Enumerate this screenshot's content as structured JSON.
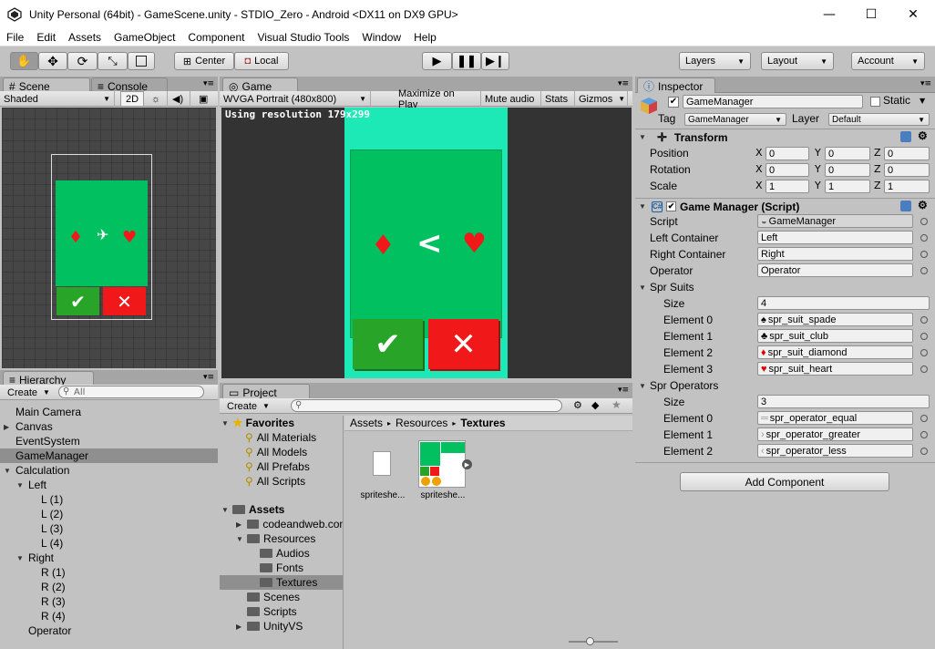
{
  "window": {
    "title": "Unity Personal (64bit) - GameScene.unity - STDIO_Zero - Android <DX11 on DX9 GPU>",
    "minimize": "—",
    "maximize": "☐",
    "close": "✕"
  },
  "menu": [
    "File",
    "Edit",
    "Assets",
    "GameObject",
    "Component",
    "Visual Studio Tools",
    "Window",
    "Help"
  ],
  "toolbar": {
    "center_label": "Center",
    "local_label": "Local",
    "layers_label": "Layers",
    "layout_label": "Layout",
    "account_label": "Account"
  },
  "scene": {
    "tab_label": "Scene",
    "console_tab_label": "Console",
    "shading": "Shaded",
    "mode2d": "2D"
  },
  "game": {
    "tab_label": "Game",
    "aspect": "WVGA Portrait (480x800)",
    "maximize_on_play": "Maximize on Play",
    "mute_audio": "Mute audio",
    "stats": "Stats",
    "gizmos": "Gizmos",
    "resolution_text": "Using resolution 179x299"
  },
  "hierarchy": {
    "tab_label": "Hierarchy",
    "create_label": "Create",
    "search_placeholder": "All",
    "items": [
      {
        "label": "Main Camera"
      },
      {
        "label": "Canvas"
      },
      {
        "label": "EventSystem"
      },
      {
        "label": "GameManager"
      },
      {
        "label": "Calculation"
      },
      {
        "label": "Left"
      },
      {
        "label": "L (1)"
      },
      {
        "label": "L (2)"
      },
      {
        "label": "L (3)"
      },
      {
        "label": "L (4)"
      },
      {
        "label": "Right"
      },
      {
        "label": "R (1)"
      },
      {
        "label": "R (2)"
      },
      {
        "label": "R (3)"
      },
      {
        "label": "R (4)"
      },
      {
        "label": "Operator"
      }
    ]
  },
  "project": {
    "tab_label": "Project",
    "create_label": "Create",
    "favorites_label": "Favorites",
    "favorites": [
      "All Materials",
      "All Models",
      "All Prefabs",
      "All Scripts"
    ],
    "assets_label": "Assets",
    "assets": [
      "codeandweb.com",
      "Resources",
      "Audios",
      "Fonts",
      "Textures",
      "Scenes",
      "Scripts",
      "UnityVS"
    ],
    "breadcrumb": [
      "Assets",
      "Resources",
      "Textures"
    ],
    "files": [
      "spritesheet",
      "spritesheet"
    ],
    "file_display": [
      "spriteshe...",
      "spriteshe..."
    ]
  },
  "inspector": {
    "tab_label": "Inspector",
    "object_name": "GameManager",
    "static_label": "Static",
    "tag_label": "Tag",
    "tag_value": "GameManager",
    "layer_label": "Layer",
    "layer_value": "Default",
    "transform": {
      "title": "Transform",
      "position_label": "Position",
      "rotation_label": "Rotation",
      "scale_label": "Scale",
      "position": {
        "x": "0",
        "y": "0",
        "z": "0"
      },
      "rotation": {
        "x": "0",
        "y": "0",
        "z": "0"
      },
      "scale": {
        "x": "1",
        "y": "1",
        "z": "1"
      },
      "axis_x": "X",
      "axis_y": "Y",
      "axis_z": "Z"
    },
    "script_component": {
      "title": "Game Manager (Script)",
      "script_label": "Script",
      "script_value": "GameManager",
      "left_container_label": "Left Container",
      "left_container_value": "Left",
      "right_container_label": "Right Container",
      "right_container_value": "Right",
      "operator_label": "Operator",
      "operator_value": "Operator",
      "spr_suits_label": "Spr Suits",
      "size_label": "Size",
      "suits_size": "4",
      "suits": [
        {
          "label": "Element 0",
          "value": "spr_suit_spade",
          "icon": "♠",
          "color": "#000000"
        },
        {
          "label": "Element 1",
          "value": "spr_suit_club",
          "icon": "♣",
          "color": "#000000"
        },
        {
          "label": "Element 2",
          "value": "spr_suit_diamond",
          "icon": "♦",
          "color": "#e00000"
        },
        {
          "label": "Element 3",
          "value": "spr_suit_heart",
          "icon": "♥",
          "color": "#e00000"
        }
      ],
      "spr_operators_label": "Spr Operators",
      "operators_size": "3",
      "operators": [
        {
          "label": "Element 0",
          "value": "spr_operator_equal",
          "icon": "═"
        },
        {
          "label": "Element 1",
          "value": "spr_operator_greater",
          "icon": "›"
        },
        {
          "label": "Element 2",
          "value": "spr_operator_less",
          "icon": "‹"
        }
      ]
    },
    "add_component": "Add Component"
  },
  "colors": {
    "card_green": "#00c060",
    "game_bg": "#1de9b6",
    "check_green": "#28a428",
    "cross_red": "#f01818",
    "suit_red": "#f01818"
  }
}
